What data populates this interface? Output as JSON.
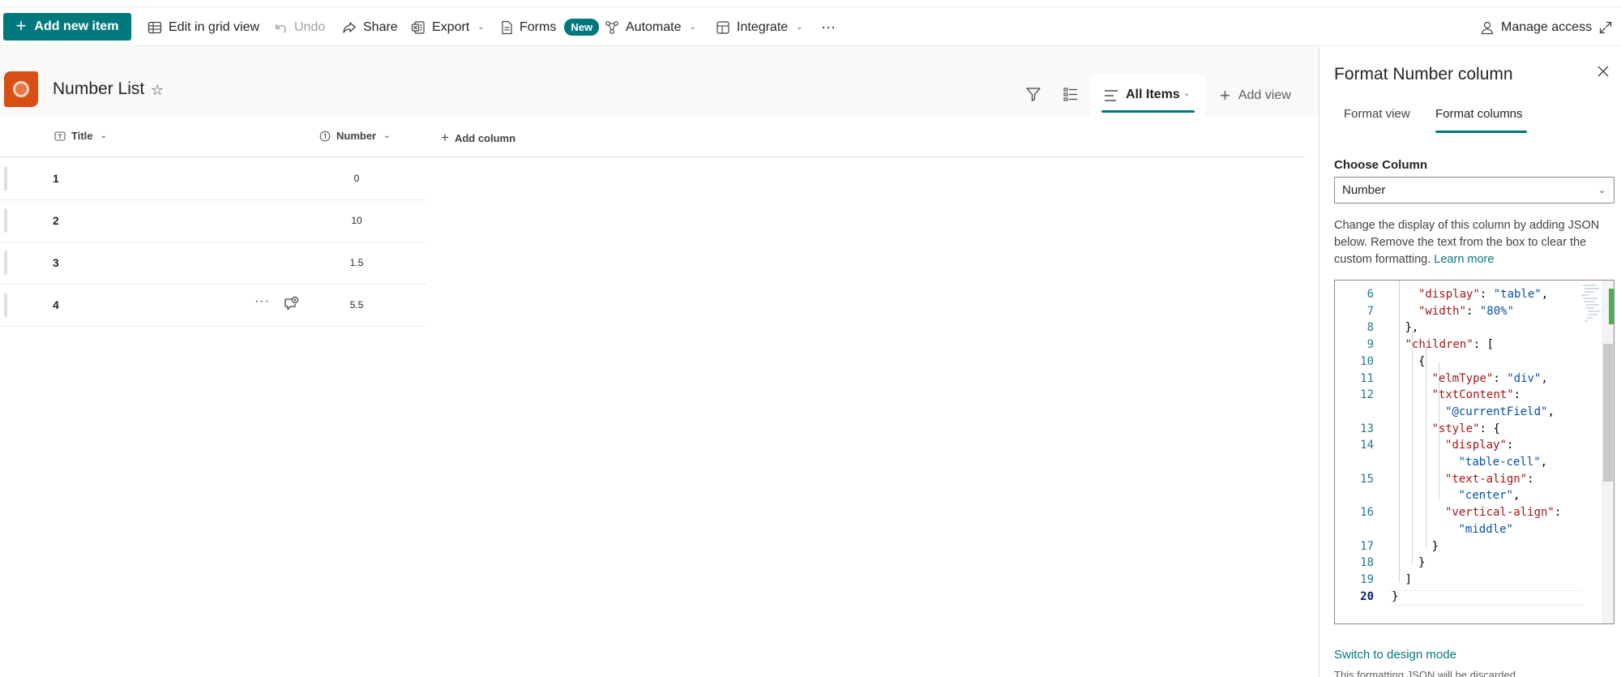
{
  "command_bar": {
    "new_item": "Add new item",
    "edit_grid": "Edit in grid view",
    "undo": "Undo",
    "share": "Share",
    "export": "Export",
    "forms": "Forms",
    "forms_badge": "New",
    "automate": "Automate",
    "integrate": "Integrate",
    "overflow": "···",
    "manage_access": "Manage access"
  },
  "list": {
    "title": "Number List",
    "view_name": "All Items",
    "add_view": "Add view",
    "columns": {
      "title": "Title",
      "number": "Number",
      "add": "Add column"
    },
    "rows": [
      {
        "title": "1",
        "number": "0"
      },
      {
        "title": "2",
        "number": "10"
      },
      {
        "title": "3",
        "number": "1.5"
      },
      {
        "title": "4",
        "number": "5.5"
      }
    ],
    "row_more": "···"
  },
  "panel": {
    "title": "Format Number column",
    "tabs": {
      "view": "Format view",
      "columns": "Format columns"
    },
    "choose_label": "Choose Column",
    "selected_column": "Number",
    "help_text": "Change the display of this column by adding JSON below. Remove the text from the box to clear the custom formatting.",
    "learn_more": "Learn more",
    "editor": {
      "line_numbers": [
        "6",
        "7",
        "8",
        "9",
        "10",
        "11",
        "12",
        "",
        "13",
        "14",
        "",
        "15",
        "",
        "16",
        "",
        "17",
        "18",
        "19",
        "20"
      ],
      "lines": [
        {
          "i": 2,
          "parts": [
            [
              "tk-key",
              "\"display\""
            ],
            [
              "tk-p",
              ": "
            ],
            [
              "tk-str",
              "\"table\""
            ],
            [
              "tk-p",
              ","
            ]
          ]
        },
        {
          "i": 2,
          "parts": [
            [
              "tk-key",
              "\"width\""
            ],
            [
              "tk-p",
              ": "
            ],
            [
              "tk-str",
              "\"80%\""
            ]
          ]
        },
        {
          "i": 1,
          "parts": [
            [
              "tk-p",
              "},"
            ]
          ]
        },
        {
          "i": 1,
          "parts": [
            [
              "tk-key",
              "\"children\""
            ],
            [
              "tk-p",
              ": ["
            ]
          ]
        },
        {
          "i": 2,
          "parts": [
            [
              "tk-p",
              "{"
            ]
          ]
        },
        {
          "i": 3,
          "parts": [
            [
              "tk-key",
              "\"elmType\""
            ],
            [
              "tk-p",
              ": "
            ],
            [
              "tk-str",
              "\"div\""
            ],
            [
              "tk-p",
              ","
            ]
          ]
        },
        {
          "i": 3,
          "parts": [
            [
              "tk-key",
              "\"txtContent\""
            ],
            [
              "tk-p",
              ":"
            ]
          ]
        },
        {
          "i": 4,
          "parts": [
            [
              "tk-str",
              "\"@currentField\""
            ],
            [
              "tk-p",
              ","
            ]
          ]
        },
        {
          "i": 3,
          "parts": [
            [
              "tk-key",
              "\"style\""
            ],
            [
              "tk-p",
              ": {"
            ]
          ]
        },
        {
          "i": 4,
          "parts": [
            [
              "tk-key",
              "\"display\""
            ],
            [
              "tk-p",
              ":"
            ]
          ]
        },
        {
          "i": 5,
          "parts": [
            [
              "tk-str",
              "\"table-cell\""
            ],
            [
              "tk-p",
              ","
            ]
          ]
        },
        {
          "i": 4,
          "parts": [
            [
              "tk-key",
              "\"text-align\""
            ],
            [
              "tk-p",
              ":"
            ]
          ]
        },
        {
          "i": 5,
          "parts": [
            [
              "tk-str",
              "\"center\""
            ],
            [
              "tk-p",
              ","
            ]
          ]
        },
        {
          "i": 4,
          "parts": [
            [
              "tk-key",
              "\"vertical-align\""
            ],
            [
              "tk-p",
              ":"
            ]
          ]
        },
        {
          "i": 5,
          "parts": [
            [
              "tk-str",
              "\"middle\""
            ]
          ]
        },
        {
          "i": 3,
          "parts": [
            [
              "tk-p",
              "}"
            ]
          ]
        },
        {
          "i": 2,
          "parts": [
            [
              "tk-p",
              "}"
            ]
          ]
        },
        {
          "i": 1,
          "parts": [
            [
              "tk-p",
              "]"
            ]
          ]
        },
        {
          "i": 0,
          "parts": [
            [
              "tk-p",
              "}"
            ]
          ]
        }
      ]
    },
    "switch_link": "Switch to design mode",
    "note": "This formatting JSON will be discarded"
  },
  "colors": {
    "accent": "#03787c",
    "site_logo": "#d84f14"
  }
}
